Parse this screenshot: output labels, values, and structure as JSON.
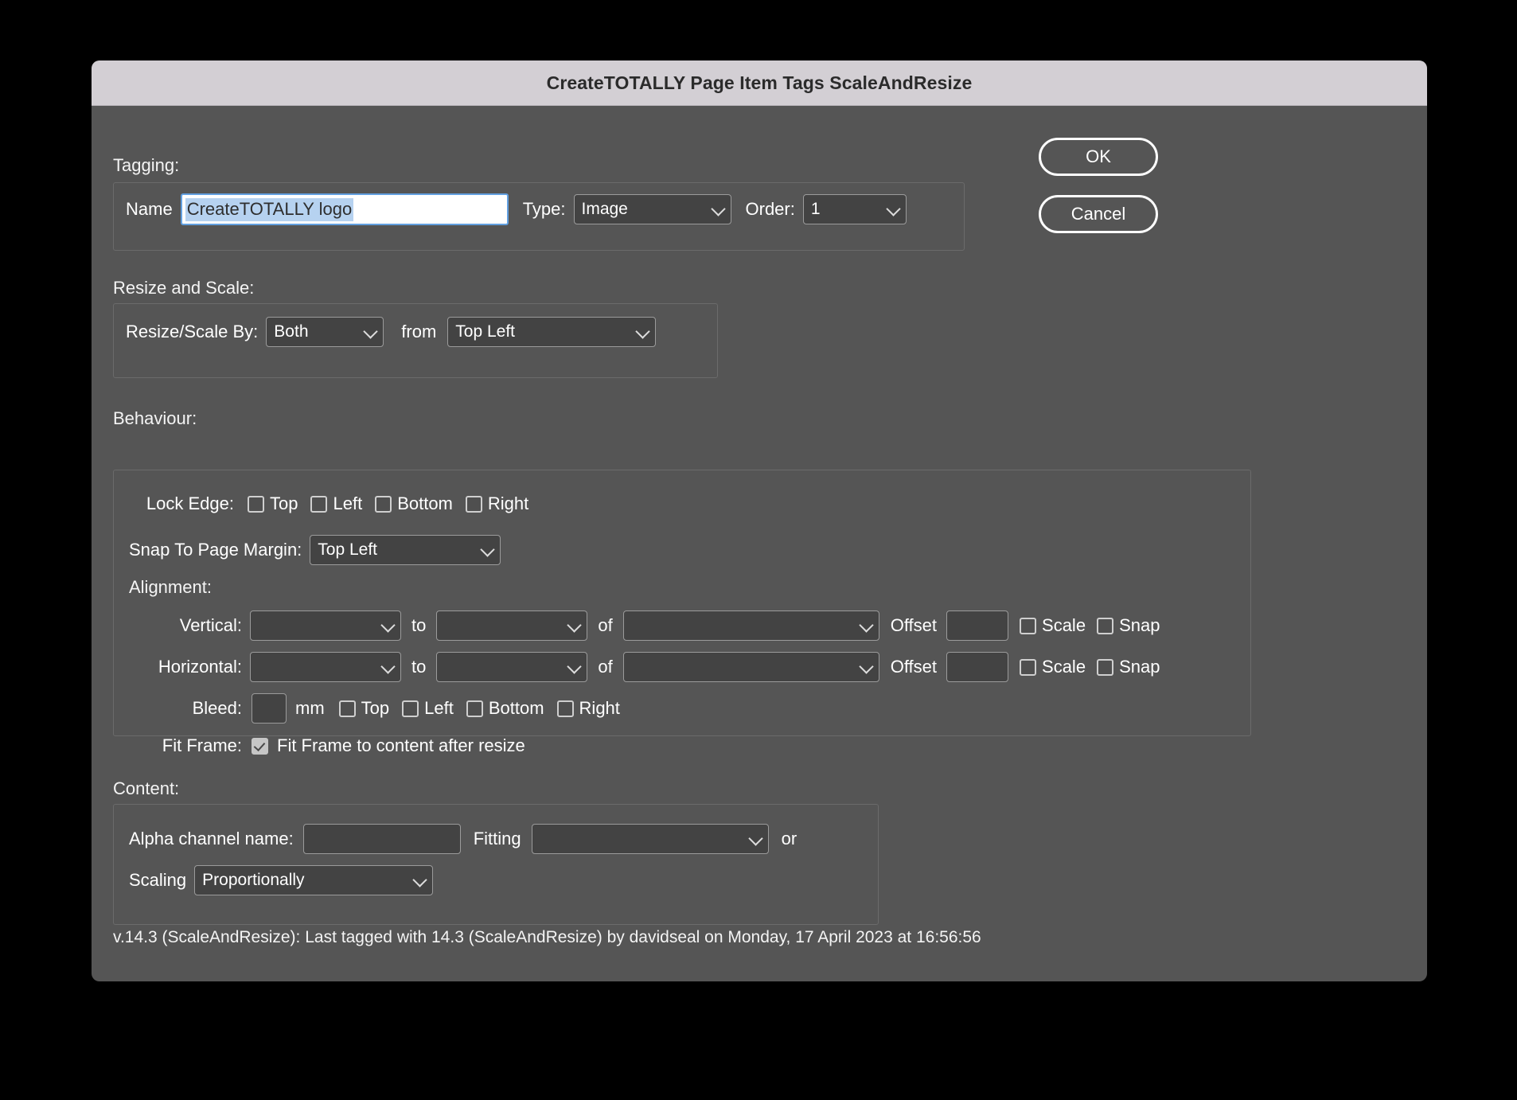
{
  "window": {
    "title": "CreateTOTALLY Page Item Tags ScaleAndResize"
  },
  "colors": {
    "titlebar_bg": "#d3cfd4",
    "dialog_bg": "#555555",
    "control_bg": "#434343",
    "control_border": "#9b9b9b",
    "selection_highlight": "#b6d2f0",
    "focus_border": "#62a0e0",
    "text": "#ffffff"
  },
  "actions": {
    "ok_label": "OK",
    "cancel_label": "Cancel"
  },
  "tagging": {
    "section_label": "Tagging:",
    "name_label": "Name",
    "name_value": "CreateTOTALLY logo",
    "name_placeholder": "",
    "type_label": "Type:",
    "type_value": "Image",
    "order_label": "Order:",
    "order_value": "1"
  },
  "resize_and_scale": {
    "section_label": "Resize and Scale:",
    "by_label": "Resize/Scale By:",
    "by_value": "Both",
    "from_label": "from",
    "from_value": "Top Left"
  },
  "behaviour": {
    "section_label": "Behaviour:",
    "lock_edge_label": "Lock Edge:",
    "lock_edges": [
      {
        "label": "Top",
        "checked": false
      },
      {
        "label": "Left",
        "checked": false
      },
      {
        "label": "Bottom",
        "checked": false
      },
      {
        "label": "Right",
        "checked": false
      }
    ],
    "snap_label": "Snap To Page Margin:",
    "snap_value": "Top Left",
    "alignment_label": "Alignment:",
    "to_label": "to",
    "of_label": "of",
    "offset_label": "Offset",
    "scale_label": "Scale",
    "snap_checkbox_label": "Snap",
    "alignment_rows": [
      {
        "label": "Vertical:",
        "first_value": "",
        "second_value": "",
        "third_value": "",
        "offset_value": "",
        "scale_checked": false,
        "snap_checked": false
      },
      {
        "label": "Horizontal:",
        "first_value": "",
        "second_value": "",
        "third_value": "",
        "offset_value": "",
        "scale_checked": false,
        "snap_checked": false
      }
    ],
    "bleed_label": "Bleed:",
    "bleed_value": "",
    "bleed_unit": "mm",
    "bleed_edges": [
      {
        "label": "Top",
        "checked": false
      },
      {
        "label": "Left",
        "checked": false
      },
      {
        "label": "Bottom",
        "checked": false
      },
      {
        "label": "Right",
        "checked": false
      }
    ],
    "fit_frame_label": "Fit Frame:",
    "fit_frame_checkbox_label": "Fit Frame to content after resize",
    "fit_frame_checked": true
  },
  "content": {
    "section_label": "Content:",
    "alpha_label": "Alpha channel name:",
    "alpha_value": "",
    "fitting_label": "Fitting",
    "fitting_value": "",
    "or_label": "or",
    "scaling_label": "Scaling",
    "scaling_value": "Proportionally"
  },
  "footer": {
    "status": "v.14.3 (ScaleAndResize):  Last tagged with 14.3 (ScaleAndResize) by davidseal  on Monday, 17 April 2023 at 16:56:56"
  }
}
